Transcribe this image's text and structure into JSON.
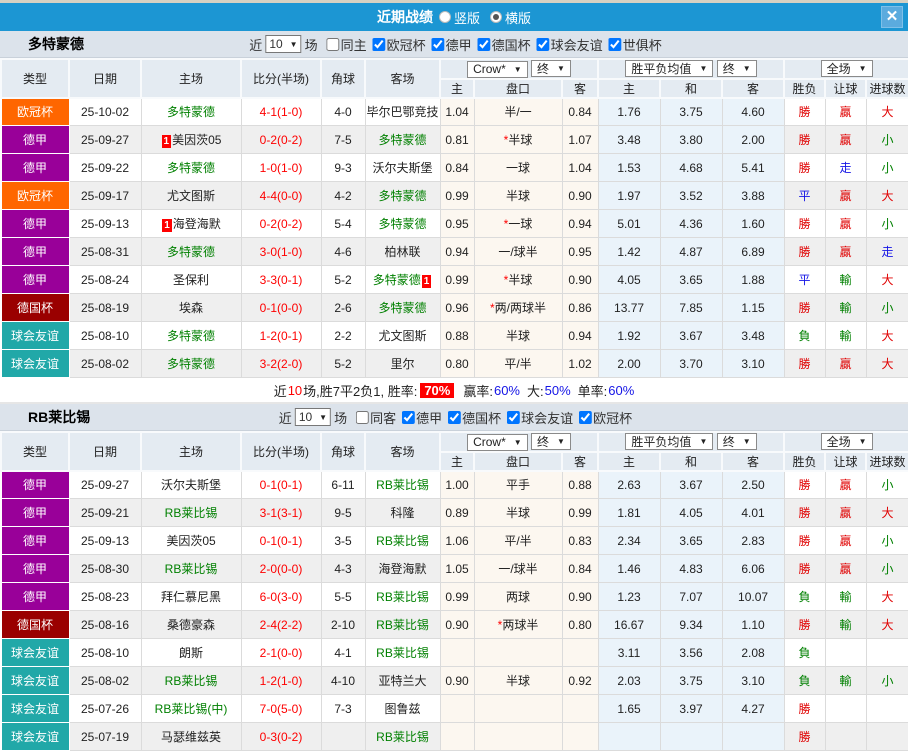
{
  "titlebar": {
    "title": "近期战绩",
    "radios": [
      {
        "label": "竖版",
        "checked": false
      },
      {
        "label": "横版",
        "checked": true
      }
    ],
    "close_label": "✕"
  },
  "type_colors": {
    "欧冠杯": "#FF6600",
    "德甲": "#990099",
    "德国杯": "#9A0000",
    "球会友谊": "#21A8A8"
  },
  "result_colors": {
    "勝": "#E00000",
    "平": "#1414E6",
    "負": "#008000",
    "贏": "#E00000",
    "走": "#1414E6",
    "輸": "#008000",
    "大": "#E00000",
    "小": "#008000"
  },
  "table_header": {
    "cols": [
      "类型",
      "日期",
      "主场",
      "比分(半场)",
      "角球",
      "客场"
    ],
    "dropdowns": {
      "odds": "Crow*",
      "odds_time": "终",
      "avg": "胜平负均值",
      "avg_time": "终",
      "scope": "全场"
    },
    "subcols": [
      "主",
      "盘口",
      "客",
      "主",
      "和",
      "客",
      "胜负",
      "让球",
      "进球数"
    ]
  },
  "sections": [
    {
      "team": "多特蒙德",
      "filter": {
        "near": "近",
        "count": "10",
        "games": "场",
        "same": {
          "label": "同主",
          "checked": false
        },
        "leagues": [
          {
            "label": "欧冠杯",
            "checked": true
          },
          {
            "label": "德甲",
            "checked": true
          },
          {
            "label": "德国杯",
            "checked": true
          },
          {
            "label": "球会友谊",
            "checked": true
          },
          {
            "label": "世俱杯",
            "checked": true
          }
        ]
      },
      "rows": [
        {
          "type": "欧冠杯",
          "date": "25-10-02",
          "home": {
            "name": "多特蒙德",
            "green": true
          },
          "score": "4-1(1-0)",
          "corner": "4-0",
          "away": {
            "name": "毕尔巴鄂竞技"
          },
          "odds": [
            "1.04",
            "半/一",
            "0.84"
          ],
          "avg": [
            "1.76",
            "3.75",
            "4.60"
          ],
          "results": [
            "勝",
            "贏",
            "大"
          ]
        },
        {
          "type": "德甲",
          "date": "25-09-27",
          "home": {
            "name": "美因茨05",
            "badge": "1",
            "badge_pos": "pre"
          },
          "score": "0-2(0-2)",
          "corner": "7-5",
          "away": {
            "name": "多特蒙德",
            "green": true
          },
          "odds": [
            "0.81",
            "*半球",
            "1.07"
          ],
          "avg": [
            "3.48",
            "3.80",
            "2.00"
          ],
          "results": [
            "勝",
            "贏",
            "小"
          ]
        },
        {
          "type": "德甲",
          "date": "25-09-22",
          "home": {
            "name": "多特蒙德",
            "green": true
          },
          "score": "1-0(1-0)",
          "corner": "9-3",
          "away": {
            "name": "沃尔夫斯堡"
          },
          "odds": [
            "0.84",
            "一球",
            "1.04"
          ],
          "avg": [
            "1.53",
            "4.68",
            "5.41"
          ],
          "results": [
            "勝",
            "走",
            "小"
          ]
        },
        {
          "type": "欧冠杯",
          "date": "25-09-17",
          "home": {
            "name": "尤文图斯"
          },
          "score": "4-4(0-0)",
          "corner": "4-2",
          "away": {
            "name": "多特蒙德",
            "green": true
          },
          "odds": [
            "0.99",
            "半球",
            "0.90"
          ],
          "avg": [
            "1.97",
            "3.52",
            "3.88"
          ],
          "results": [
            "平",
            "贏",
            "大"
          ]
        },
        {
          "type": "德甲",
          "date": "25-09-13",
          "home": {
            "name": "海登海默",
            "badge": "1",
            "badge_pos": "pre"
          },
          "score": "0-2(0-2)",
          "corner": "5-4",
          "away": {
            "name": "多特蒙德",
            "green": true
          },
          "odds": [
            "0.95",
            "*一球",
            "0.94"
          ],
          "avg": [
            "5.01",
            "4.36",
            "1.60"
          ],
          "results": [
            "勝",
            "贏",
            "小"
          ]
        },
        {
          "type": "德甲",
          "date": "25-08-31",
          "home": {
            "name": "多特蒙德",
            "green": true
          },
          "score": "3-0(1-0)",
          "corner": "4-6",
          "away": {
            "name": "柏林联"
          },
          "odds": [
            "0.94",
            "一/球半",
            "0.95"
          ],
          "avg": [
            "1.42",
            "4.87",
            "6.89"
          ],
          "results": [
            "勝",
            "贏",
            "走"
          ]
        },
        {
          "type": "德甲",
          "date": "25-08-24",
          "home": {
            "name": "圣保利"
          },
          "score": "3-3(0-1)",
          "corner": "5-2",
          "away": {
            "name": "多特蒙德",
            "green": true,
            "badge": "1",
            "badge_pos": "post"
          },
          "odds": [
            "0.99",
            "*半球",
            "0.90"
          ],
          "avg": [
            "4.05",
            "3.65",
            "1.88"
          ],
          "results": [
            "平",
            "輸",
            "大"
          ]
        },
        {
          "type": "德国杯",
          "date": "25-08-19",
          "home": {
            "name": "埃森"
          },
          "score": "0-1(0-0)",
          "corner": "2-6",
          "away": {
            "name": "多特蒙德",
            "green": true
          },
          "odds": [
            "0.96",
            "*两/两球半",
            "0.86"
          ],
          "avg": [
            "13.77",
            "7.85",
            "1.15"
          ],
          "results": [
            "勝",
            "輸",
            "小"
          ]
        },
        {
          "type": "球会友谊",
          "date": "25-08-10",
          "home": {
            "name": "多特蒙德",
            "green": true
          },
          "score": "1-2(0-1)",
          "corner": "2-2",
          "away": {
            "name": "尤文图斯"
          },
          "odds": [
            "0.88",
            "半球",
            "0.94"
          ],
          "avg": [
            "1.92",
            "3.67",
            "3.48"
          ],
          "results": [
            "負",
            "輸",
            "大"
          ]
        },
        {
          "type": "球会友谊",
          "date": "25-08-02",
          "home": {
            "name": "多特蒙德",
            "green": true
          },
          "score": "3-2(2-0)",
          "corner": "5-2",
          "away": {
            "name": "里尔"
          },
          "odds": [
            "0.80",
            "平/半",
            "1.02"
          ],
          "avg": [
            "2.00",
            "3.70",
            "3.10"
          ],
          "results": [
            "勝",
            "贏",
            "大"
          ]
        }
      ],
      "summary": {
        "pre": "近",
        "count": "10",
        "mid": "场,胜7平2负1, 胜率:",
        "rate": "70%",
        "stats": [
          {
            "label": "赢率:",
            "value": "60%"
          },
          {
            "label": "大:",
            "value": "50%"
          },
          {
            "label": "单率:",
            "value": "60%"
          }
        ]
      }
    },
    {
      "team": "RB莱比锡",
      "filter": {
        "near": "近",
        "count": "10",
        "games": "场",
        "same": {
          "label": "同客",
          "checked": false
        },
        "leagues": [
          {
            "label": "德甲",
            "checked": true
          },
          {
            "label": "德国杯",
            "checked": true
          },
          {
            "label": "球会友谊",
            "checked": true
          },
          {
            "label": "欧冠杯",
            "checked": true
          }
        ]
      },
      "rows": [
        {
          "type": "德甲",
          "date": "25-09-27",
          "home": {
            "name": "沃尔夫斯堡"
          },
          "score": "0-1(0-1)",
          "corner": "6-11",
          "away": {
            "name": "RB莱比锡",
            "green": true
          },
          "odds": [
            "1.00",
            "平手",
            "0.88"
          ],
          "avg": [
            "2.63",
            "3.67",
            "2.50"
          ],
          "results": [
            "勝",
            "贏",
            "小"
          ]
        },
        {
          "type": "德甲",
          "date": "25-09-21",
          "home": {
            "name": "RB莱比锡",
            "green": true
          },
          "score": "3-1(3-1)",
          "corner": "9-5",
          "away": {
            "name": "科隆"
          },
          "odds": [
            "0.89",
            "半球",
            "0.99"
          ],
          "avg": [
            "1.81",
            "4.05",
            "4.01"
          ],
          "results": [
            "勝",
            "贏",
            "大"
          ]
        },
        {
          "type": "德甲",
          "date": "25-09-13",
          "home": {
            "name": "美因茨05"
          },
          "score": "0-1(0-1)",
          "corner": "3-5",
          "away": {
            "name": "RB莱比锡",
            "green": true
          },
          "odds": [
            "1.06",
            "平/半",
            "0.83"
          ],
          "avg": [
            "2.34",
            "3.65",
            "2.83"
          ],
          "results": [
            "勝",
            "贏",
            "小"
          ]
        },
        {
          "type": "德甲",
          "date": "25-08-30",
          "home": {
            "name": "RB莱比锡",
            "green": true
          },
          "score": "2-0(0-0)",
          "corner": "4-3",
          "away": {
            "name": "海登海默"
          },
          "odds": [
            "1.05",
            "一/球半",
            "0.84"
          ],
          "avg": [
            "1.46",
            "4.83",
            "6.06"
          ],
          "results": [
            "勝",
            "贏",
            "小"
          ]
        },
        {
          "type": "德甲",
          "date": "25-08-23",
          "home": {
            "name": "拜仁慕尼黑"
          },
          "score": "6-0(3-0)",
          "corner": "5-5",
          "away": {
            "name": "RB莱比锡",
            "green": true
          },
          "odds": [
            "0.99",
            "两球",
            "0.90"
          ],
          "avg": [
            "1.23",
            "7.07",
            "10.07"
          ],
          "results": [
            "負",
            "輸",
            "大"
          ]
        },
        {
          "type": "德国杯",
          "date": "25-08-16",
          "home": {
            "name": "桑德豪森"
          },
          "score": "2-4(2-2)",
          "corner": "2-10",
          "away": {
            "name": "RB莱比锡",
            "green": true
          },
          "odds": [
            "0.90",
            "*两球半",
            "0.80"
          ],
          "avg": [
            "16.67",
            "9.34",
            "1.10"
          ],
          "results": [
            "勝",
            "輸",
            "大"
          ]
        },
        {
          "type": "球会友谊",
          "date": "25-08-10",
          "home": {
            "name": "朗斯"
          },
          "score": "2-1(0-0)",
          "corner": "4-1",
          "away": {
            "name": "RB莱比锡",
            "green": true
          },
          "odds": [
            "",
            "",
            ""
          ],
          "avg": [
            "3.11",
            "3.56",
            "2.08"
          ],
          "results": [
            "負",
            "",
            ""
          ]
        },
        {
          "type": "球会友谊",
          "date": "25-08-02",
          "home": {
            "name": "RB莱比锡",
            "green": true
          },
          "score": "1-2(1-0)",
          "corner": "4-10",
          "away": {
            "name": "亚特兰大"
          },
          "odds": [
            "0.90",
            "半球",
            "0.92"
          ],
          "avg": [
            "2.03",
            "3.75",
            "3.10"
          ],
          "results": [
            "負",
            "輸",
            "小"
          ]
        },
        {
          "type": "球会友谊",
          "date": "25-07-26",
          "home": {
            "name": "RB莱比锡(中)",
            "green": true
          },
          "score": "7-0(5-0)",
          "corner": "7-3",
          "away": {
            "name": "图鲁兹"
          },
          "odds": [
            "",
            "",
            ""
          ],
          "avg": [
            "1.65",
            "3.97",
            "4.27"
          ],
          "results": [
            "勝",
            "",
            ""
          ]
        },
        {
          "type": "球会友谊",
          "date": "25-07-19",
          "home": {
            "name": "马瑟维兹英"
          },
          "score": "0-3(0-2)",
          "corner": "",
          "away": {
            "name": "RB莱比锡",
            "green": true
          },
          "odds": [
            "",
            "",
            ""
          ],
          "avg": [
            "",
            "",
            ""
          ],
          "results": [
            "勝",
            "",
            ""
          ]
        }
      ],
      "summary": null
    }
  ]
}
